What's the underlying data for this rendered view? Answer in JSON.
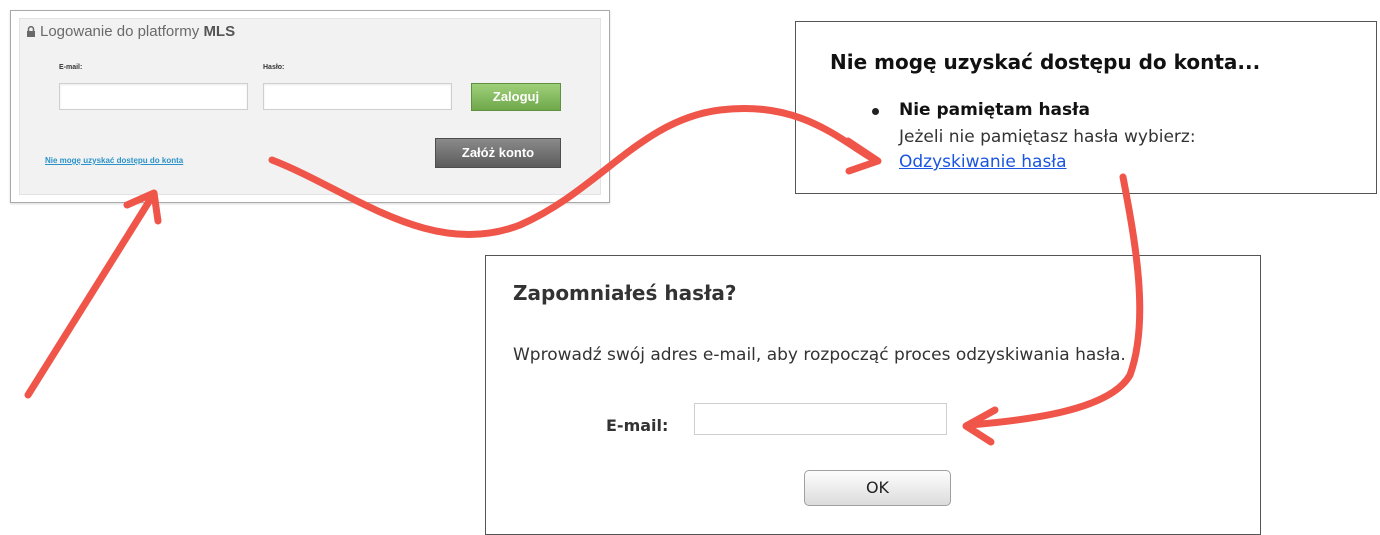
{
  "login": {
    "title_prefix": "Logowanie do platformy ",
    "title_brand": "MLS",
    "email_label": "E-mail:",
    "password_label": "Hasło:",
    "email_value": "",
    "password_value": "",
    "login_button": "Zaloguj",
    "create_account_button": "Załóż konto",
    "no_access_link": "Nie mogę uzyskać dostępu do konta"
  },
  "access": {
    "title": "Nie mogę uzyskać dostępu do konta...",
    "item_title": "Nie pamiętam hasła",
    "item_text": "Jeżeli nie pamiętasz hasła wybierz:",
    "item_link": "Odzyskiwanie hasła"
  },
  "recover": {
    "title": "Zapomniałeś hasła?",
    "description": "Wprowadź swój adres e-mail, aby rozpocząć proces odzyskiwania hasła.",
    "email_label": "E-mail:",
    "email_value": "",
    "ok_button": "OK"
  },
  "colors": {
    "arrow": "#f0554a",
    "login_green": "#7cb556",
    "link_blue": "#1a55e0"
  },
  "icons": [
    "lock-icon",
    "bullet-icon",
    "arrow"
  ]
}
